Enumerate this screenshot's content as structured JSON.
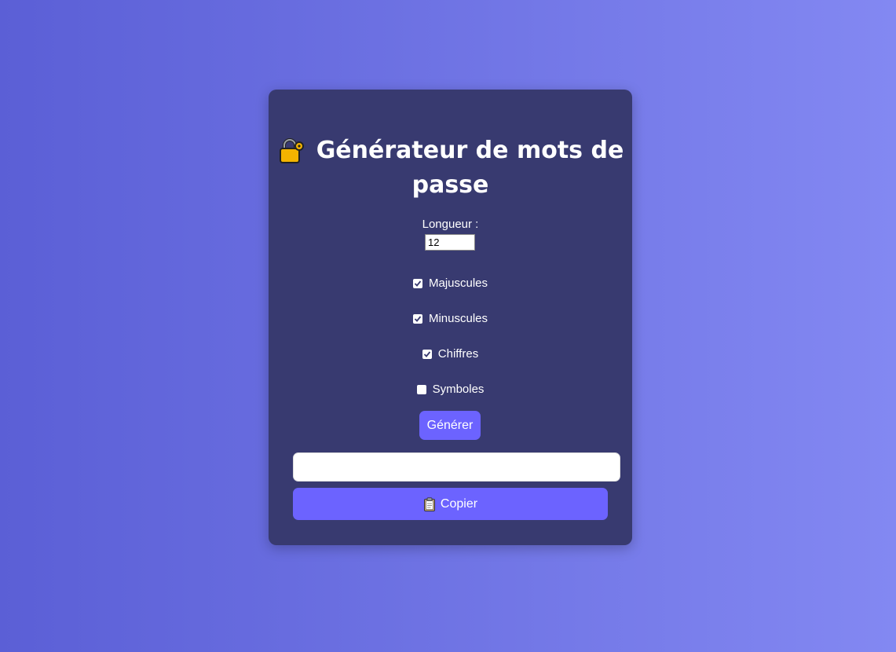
{
  "app": {
    "title": "Générateur de mots de passe"
  },
  "length": {
    "label": "Longueur :",
    "value": "12"
  },
  "options": [
    {
      "label": "Majuscules",
      "checked": true
    },
    {
      "label": "Minuscules",
      "checked": true
    },
    {
      "label": "Chiffres",
      "checked": true
    },
    {
      "label": "Symboles",
      "checked": false
    }
  ],
  "buttons": {
    "generate_label": "Générer",
    "copy_label": "Copier"
  },
  "output": {
    "value": ""
  },
  "icons": {
    "title_icon": "lock-with-key-icon",
    "copy_icon": "clipboard-icon"
  },
  "colors": {
    "accent": "#6c63ff",
    "card": "#383a70",
    "bg_start": "#5b5fd6",
    "bg_end": "#8388f2"
  }
}
